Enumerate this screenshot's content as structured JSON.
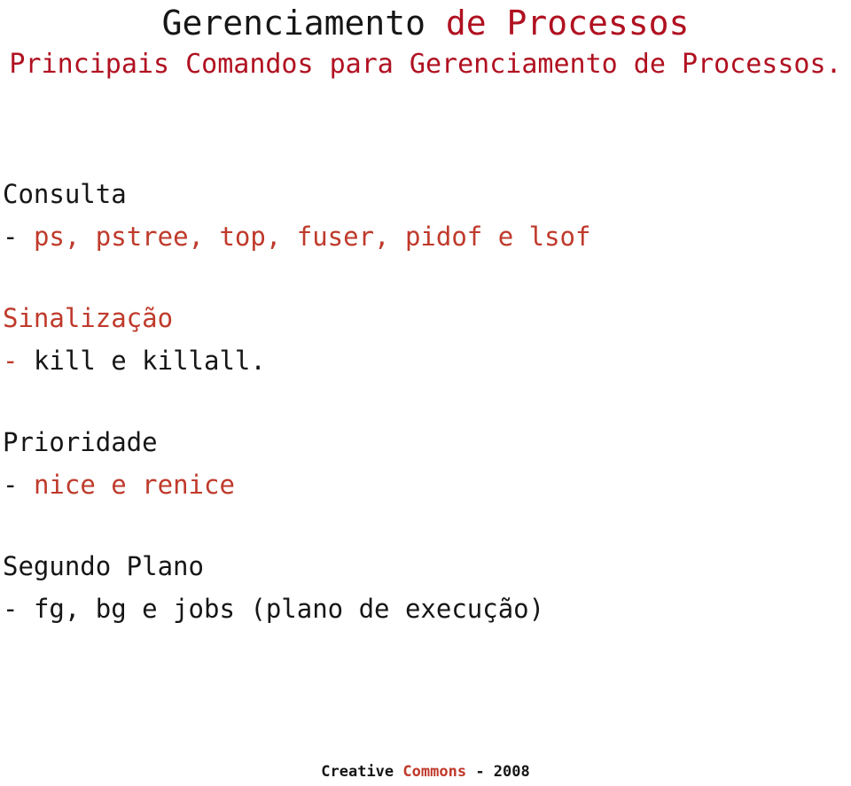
{
  "slide": {
    "title": {
      "part_black": "Gerenciamento",
      "space": " ",
      "part_red": "de Processos"
    },
    "subtitle": "Principais Comandos para Gerenciamento de Processos.",
    "sections": [
      {
        "heading": "Consulta",
        "heading_color": "#161616",
        "dash": "-",
        "dash_color": "#161616",
        "item": "ps, pstree, top, fuser, pidof e lsof",
        "item_color": "#bf3a2b"
      },
      {
        "heading": "Sinalização",
        "heading_color": "#bf3a2b",
        "dash": "-",
        "dash_color": "#bf3a2b",
        "item": "kill e killall.",
        "item_color": "#161616"
      },
      {
        "heading": "Prioridade",
        "heading_color": "#161616",
        "dash": "-",
        "dash_color": "#161616",
        "item": "nice e renice",
        "item_color": "#bf3a2b"
      },
      {
        "heading": "Segundo Plano",
        "heading_color": "#161616",
        "dash": "-",
        "dash_color": "#161616",
        "item": "fg, bg e jobs (plano de execução)",
        "item_color": "#161616"
      }
    ],
    "footer": {
      "license_word_1": "Creative",
      "license_word_2": "Commons",
      "separator_and_year": "- 2008"
    },
    "colors": {
      "background": "#ffffff",
      "title_black": "#161616",
      "title_red": "#b01121",
      "body_black": "#161616",
      "body_red": "#bf3a2b",
      "footer_red": "#c0392b"
    }
  }
}
